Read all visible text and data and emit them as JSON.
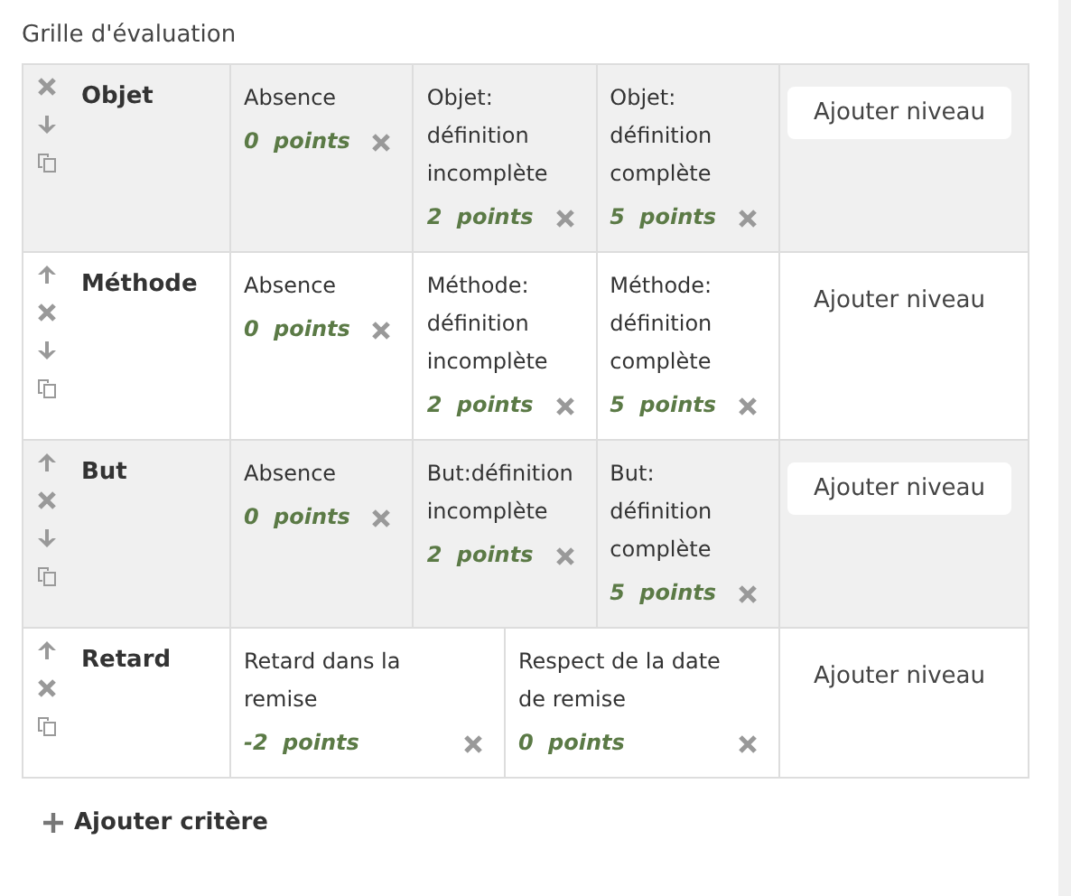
{
  "title": "Grille d'évaluation",
  "criteria": [
    {
      "name": "Objet",
      "move_up": false,
      "move_down": true,
      "levels": [
        {
          "definition": "Absence",
          "score": "0 points"
        },
        {
          "definition": "Objet: définition incomplète",
          "score": "2 points"
        },
        {
          "definition": "Objet: définition complète",
          "score": "5 points"
        }
      ],
      "add_level": "Ajouter niveau"
    },
    {
      "name": "Méthode",
      "move_up": true,
      "move_down": true,
      "levels": [
        {
          "definition": "Absence",
          "score": "0 points"
        },
        {
          "definition": "Méthode: définition incomplète",
          "score": "2 points"
        },
        {
          "definition": "Méthode: définition complète",
          "score": "5 points"
        }
      ],
      "add_level": "Ajouter niveau"
    },
    {
      "name": "But",
      "move_up": true,
      "move_down": true,
      "levels": [
        {
          "definition": "Absence",
          "score": "0 points"
        },
        {
          "definition": "But:définition incomplète",
          "score": "2 points"
        },
        {
          "definition": "But: définition complète",
          "score": "5 points"
        }
      ],
      "add_level": "Ajouter niveau"
    },
    {
      "name": "Retard",
      "move_up": true,
      "move_down": false,
      "levels": [
        {
          "definition": "Retard dans la remise",
          "score": "-2 points"
        },
        {
          "definition": "Respect de la date de remise",
          "score": "0 points"
        }
      ],
      "add_level": "Ajouter niveau"
    }
  ],
  "add_criterion": "Ajouter critère"
}
